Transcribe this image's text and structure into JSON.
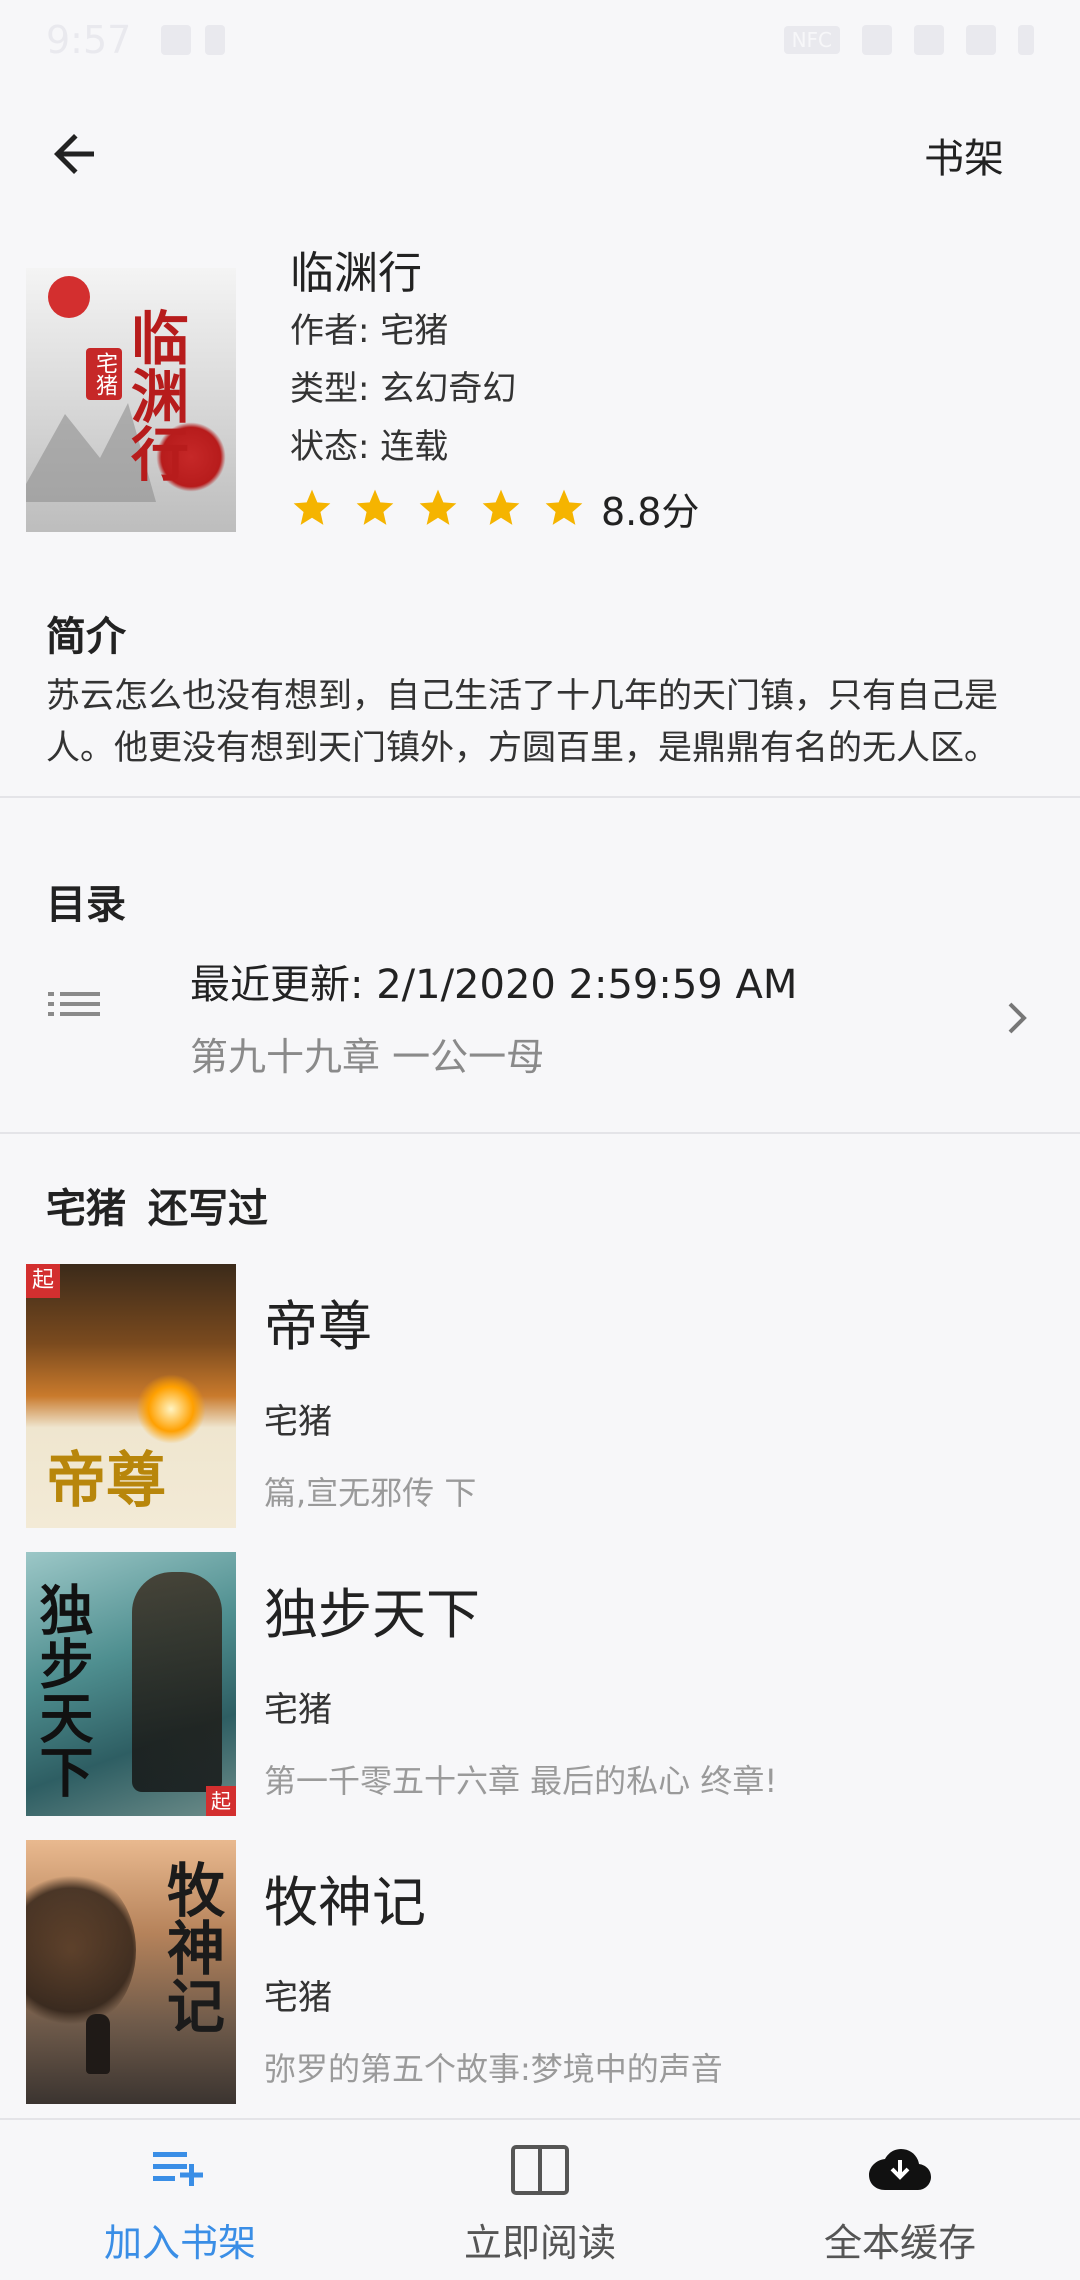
{
  "status_bar": {
    "time": "9:57",
    "battery_badge": "NFC"
  },
  "top_bar": {
    "shelf_label": "书架"
  },
  "book": {
    "title": "临渊行",
    "author_label": "作者: ",
    "author": "宅猪",
    "genre_label": "类型: ",
    "genre": "玄幻奇幻",
    "status_label": "状态: ",
    "status": "连载",
    "rating_stars": 5,
    "score": "8.8分"
  },
  "intro": {
    "title": "简介",
    "text": "苏云怎么也没有想到，自己生活了十几年的天门镇，只有自己是人。他更没有想到天门镇外，方圆百里，是鼎鼎有名的无人区。"
  },
  "toc": {
    "title": "目录",
    "updated": "最近更新: 2/1/2020 2:59:59 AM",
    "latest_chapter": "第九十九章 一公一母"
  },
  "more_by_author": {
    "author": "宅猪",
    "suffix": "还写过",
    "books": [
      {
        "title": "帝尊",
        "author": "宅猪",
        "latest": "篇,宣无邪传 下"
      },
      {
        "title": "独步天下",
        "author": "宅猪",
        "latest": "第一千零五十六章 最后的私心 终章!"
      },
      {
        "title": "牧神记",
        "author": "宅猪",
        "latest": "弥罗的第五个故事:梦境中的声音"
      }
    ]
  },
  "bottom_nav": {
    "add_shelf": "加入书架",
    "read_now": "立即阅读",
    "cache_all": "全本缓存"
  },
  "colors": {
    "accent": "#3a8ee6",
    "star": "#f5b400",
    "background": "#f7f7f9"
  }
}
